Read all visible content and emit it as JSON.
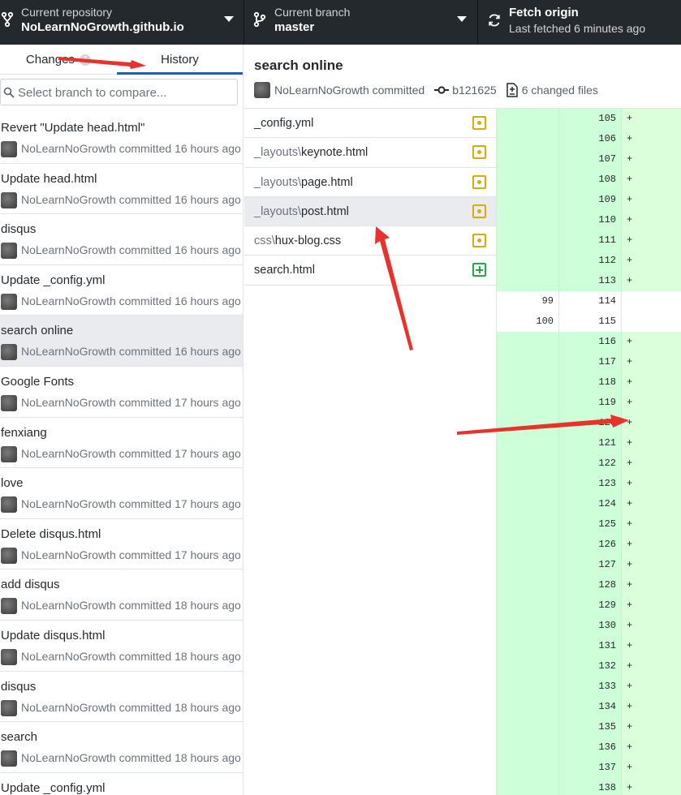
{
  "toolbar": {
    "repository": {
      "label": "Current repository",
      "value": "NoLearnNoGrowth.github.io",
      "icon": "repo-icon"
    },
    "branch": {
      "label": "Current branch",
      "value": "master",
      "icon": "git-branch-icon"
    },
    "fetch": {
      "label": "Fetch origin",
      "subtitle": "Last fetched 6 minutes ago",
      "icon": "sync-icon"
    }
  },
  "sidebar": {
    "tabs": [
      {
        "label": "Changes",
        "badge": "1",
        "active": false
      },
      {
        "label": "History",
        "active": true
      }
    ],
    "compare_placeholder": "Select branch to compare...",
    "commits": [
      {
        "title": "Revert \"Update head.html\"",
        "meta": "NoLearnNoGrowth committed 16 hours ago"
      },
      {
        "title": "Update head.html",
        "meta": "NoLearnNoGrowth committed 16 hours ago"
      },
      {
        "title": "disqus",
        "meta": "NoLearnNoGrowth committed 16 hours ago"
      },
      {
        "title": "Update _config.yml",
        "meta": "NoLearnNoGrowth committed 16 hours ago"
      },
      {
        "title": "search online",
        "meta": "NoLearnNoGrowth committed 16 hours ago",
        "selected": true
      },
      {
        "title": "Google Fonts",
        "meta": "NoLearnNoGrowth committed 17 hours ago"
      },
      {
        "title": "fenxiang",
        "meta": "NoLearnNoGrowth committed 17 hours ago"
      },
      {
        "title": "love",
        "meta": "NoLearnNoGrowth committed 17 hours ago"
      },
      {
        "title": "Delete disqus.html",
        "meta": "NoLearnNoGrowth committed 17 hours ago"
      },
      {
        "title": "add disqus",
        "meta": "NoLearnNoGrowth committed 18 hours ago"
      },
      {
        "title": "Update disqus.html",
        "meta": "NoLearnNoGrowth committed 18 hours ago"
      },
      {
        "title": "disqus",
        "meta": "NoLearnNoGrowth committed 18 hours ago"
      },
      {
        "title": "search",
        "meta": "NoLearnNoGrowth committed 18 hours ago"
      },
      {
        "title": "Update _config.yml",
        "meta": ""
      }
    ]
  },
  "commit_header": {
    "title": "search online",
    "author_text": "NoLearnNoGrowth committed",
    "sha": "b121625",
    "changed_files": "6 changed files"
  },
  "files": [
    {
      "dir": "",
      "name": "_config.yml",
      "status": "modified"
    },
    {
      "dir": "_layouts\\",
      "name": "keynote.html",
      "status": "modified"
    },
    {
      "dir": "_layouts\\",
      "name": "page.html",
      "status": "modified"
    },
    {
      "dir": "_layouts\\",
      "name": "post.html",
      "status": "modified",
      "selected": true
    },
    {
      "dir": "css\\",
      "name": "hux-blog.css",
      "status": "modified"
    },
    {
      "dir": "",
      "name": "search.html",
      "status": "added"
    }
  ],
  "diff": [
    {
      "old": "",
      "new": "105",
      "mark": "+",
      "type": "added"
    },
    {
      "old": "",
      "new": "106",
      "mark": "+",
      "type": "added"
    },
    {
      "old": "",
      "new": "107",
      "mark": "+",
      "type": "added"
    },
    {
      "old": "",
      "new": "108",
      "mark": "+",
      "type": "added"
    },
    {
      "old": "",
      "new": "109",
      "mark": "+",
      "type": "added"
    },
    {
      "old": "",
      "new": "110",
      "mark": "+",
      "type": "added"
    },
    {
      "old": "",
      "new": "111",
      "mark": "+",
      "type": "added"
    },
    {
      "old": "",
      "new": "112",
      "mark": "+",
      "type": "added"
    },
    {
      "old": "",
      "new": "113",
      "mark": "+",
      "type": "added"
    },
    {
      "old": "99",
      "new": "114",
      "mark": "",
      "type": "context"
    },
    {
      "old": "100",
      "new": "115",
      "mark": "",
      "type": "context"
    },
    {
      "old": "",
      "new": "116",
      "mark": "+",
      "type": "added"
    },
    {
      "old": "",
      "new": "117",
      "mark": "+",
      "type": "added"
    },
    {
      "old": "",
      "new": "118",
      "mark": "+",
      "type": "added"
    },
    {
      "old": "",
      "new": "119",
      "mark": "+",
      "type": "added"
    },
    {
      "old": "",
      "new": "120",
      "mark": "+",
      "type": "added"
    },
    {
      "old": "",
      "new": "121",
      "mark": "+",
      "type": "added"
    },
    {
      "old": "",
      "new": "122",
      "mark": "+",
      "type": "added"
    },
    {
      "old": "",
      "new": "123",
      "mark": "+",
      "type": "added"
    },
    {
      "old": "",
      "new": "124",
      "mark": "+",
      "type": "added"
    },
    {
      "old": "",
      "new": "125",
      "mark": "+",
      "type": "added"
    },
    {
      "old": "",
      "new": "126",
      "mark": "+",
      "type": "added"
    },
    {
      "old": "",
      "new": "127",
      "mark": "+",
      "type": "added"
    },
    {
      "old": "",
      "new": "128",
      "mark": "+",
      "type": "added"
    },
    {
      "old": "",
      "new": "129",
      "mark": "+",
      "type": "added"
    },
    {
      "old": "",
      "new": "130",
      "mark": "+",
      "type": "added"
    },
    {
      "old": "",
      "new": "131",
      "mark": "+",
      "type": "added"
    },
    {
      "old": "",
      "new": "132",
      "mark": "+",
      "type": "added"
    },
    {
      "old": "",
      "new": "133",
      "mark": "+",
      "type": "added"
    },
    {
      "old": "",
      "new": "134",
      "mark": "+",
      "type": "added"
    },
    {
      "old": "",
      "new": "135",
      "mark": "+",
      "type": "added"
    },
    {
      "old": "",
      "new": "136",
      "mark": "+",
      "type": "added"
    },
    {
      "old": "",
      "new": "137",
      "mark": "+",
      "type": "added"
    },
    {
      "old": "",
      "new": "138",
      "mark": "+",
      "type": "added"
    }
  ],
  "colors": {
    "toolbar_bg": "#24292e",
    "active_tab": "#0366d6",
    "modified": "#dbab09",
    "added": "#28a745",
    "diff_added_bg": "#dbffdb",
    "annotation_arrow": "#e8322b"
  }
}
